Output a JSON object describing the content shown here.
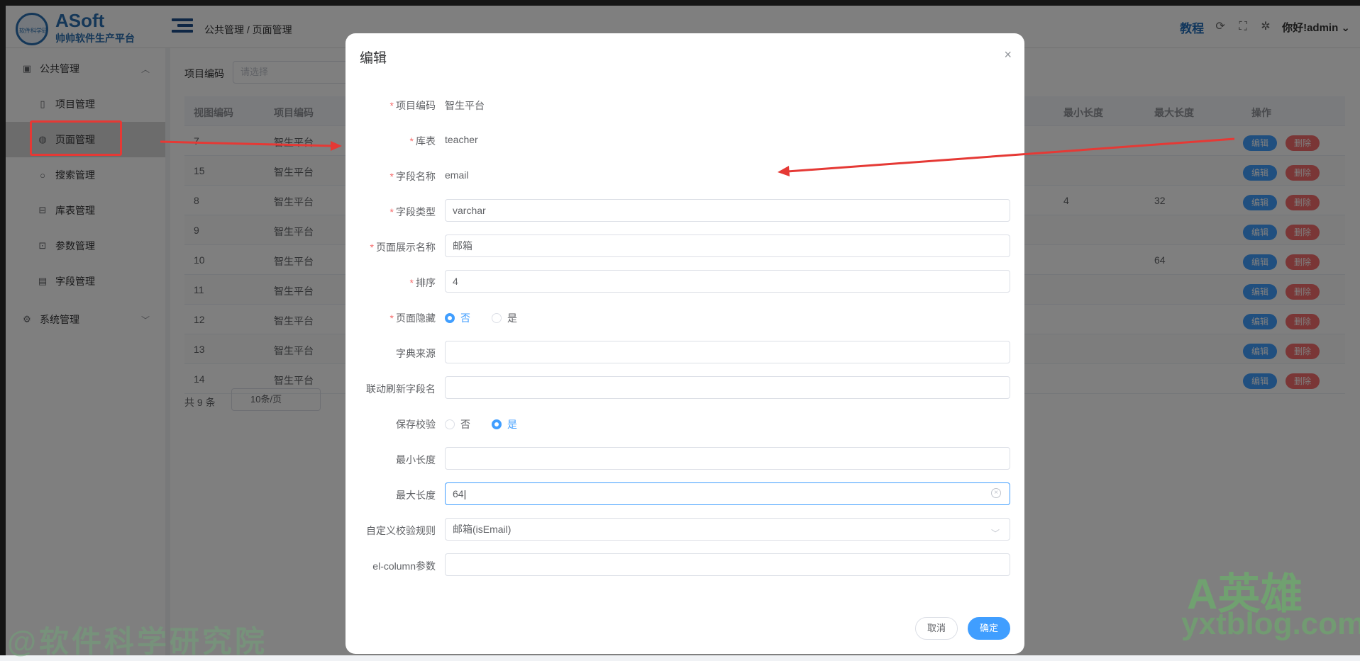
{
  "header": {
    "logo_title": "ASoft",
    "logo_sub": "帅帅软件生产平台",
    "logo_seal": "软件科学研究院",
    "breadcrumb": "公共管理 / 页面管理",
    "tutorial": "教程",
    "user": "你好!admin"
  },
  "sidebar": {
    "group1": "公共管理",
    "items": [
      "项目管理",
      "页面管理",
      "搜索管理",
      "库表管理",
      "参数管理",
      "字段管理"
    ],
    "group2": "系统管理"
  },
  "filter": {
    "label": "项目编码",
    "placeholder": "请选择"
  },
  "table": {
    "headers": [
      "视图编码",
      "项目编码",
      "最小长度",
      "最大长度",
      "操作"
    ],
    "rows": [
      {
        "id": "7",
        "project": "智生平台",
        "min": "",
        "max": ""
      },
      {
        "id": "15",
        "project": "智生平台",
        "min": "",
        "max": ""
      },
      {
        "id": "8",
        "project": "智生平台",
        "min": "4",
        "max": "32"
      },
      {
        "id": "9",
        "project": "智生平台",
        "min": "",
        "max": ""
      },
      {
        "id": "10",
        "project": "智生平台",
        "min": "",
        "max": "64"
      },
      {
        "id": "11",
        "project": "智生平台",
        "min": "",
        "max": ""
      },
      {
        "id": "12",
        "project": "智生平台",
        "min": "",
        "max": ""
      },
      {
        "id": "13",
        "project": "智生平台",
        "min": "",
        "max": ""
      },
      {
        "id": "14",
        "project": "智生平台",
        "min": "",
        "max": ""
      }
    ],
    "edit_label": "编辑",
    "delete_label": "删除"
  },
  "pager": {
    "total": "共 9 条",
    "page_size": "10条/页"
  },
  "dialog": {
    "title": "编辑",
    "close_icon": "×",
    "fields": {
      "project_code": {
        "label": "项目编码",
        "value": "智生平台"
      },
      "db_table": {
        "label": "库表",
        "value": "teacher"
      },
      "field_name": {
        "label": "字段名称",
        "value": "email"
      },
      "field_type": {
        "label": "字段类型",
        "value": "varchar"
      },
      "display_name": {
        "label": "页面展示名称",
        "value": "邮箱"
      },
      "sort": {
        "label": "排序",
        "value": "4"
      },
      "hidden": {
        "label": "页面隐藏",
        "opt_no": "否",
        "opt_yes": "是",
        "selected": "否"
      },
      "dict_source": {
        "label": "字典来源",
        "value": ""
      },
      "linked_refresh": {
        "label": "联动刷新字段名",
        "value": ""
      },
      "save_validate": {
        "label": "保存校验",
        "opt_no": "否",
        "opt_yes": "是",
        "selected": "是"
      },
      "min_length": {
        "label": "最小长度",
        "value": ""
      },
      "max_length": {
        "label": "最大长度",
        "value": "64"
      },
      "custom_rule": {
        "label": "自定义校验规则",
        "value": "邮箱(isEmail)"
      },
      "el_column": {
        "label": "el-column参数",
        "value": ""
      }
    },
    "cancel": "取消",
    "confirm": "确定"
  },
  "watermarks": {
    "left": "@软件科学研究院",
    "right_big": "A英雄",
    "right_small": "yxtblog.com"
  },
  "colors": {
    "primary": "#409eff",
    "danger": "#f56c6c",
    "annotation": "#e53935"
  }
}
